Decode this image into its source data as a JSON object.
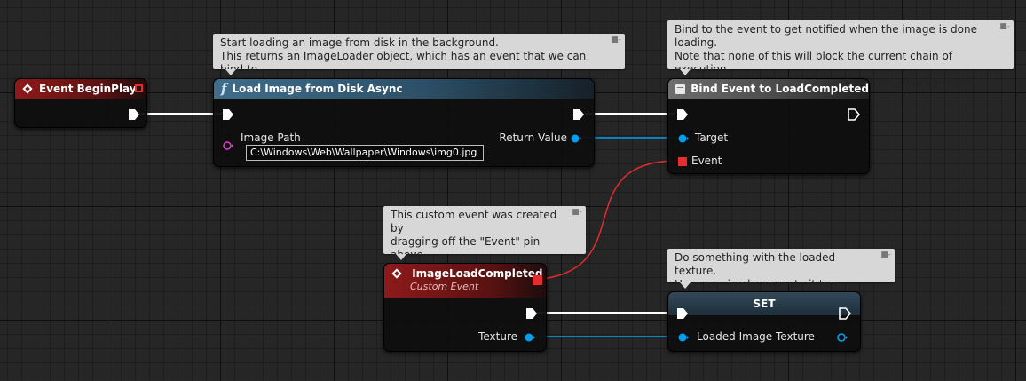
{
  "comments": {
    "load": "Start loading an image from disk in the background.\nThis returns an ImageLoader object, which has an event that we can bind to.",
    "bind": "Bind to the event to get notified when the image is done loading.\nNote that none of this will block the current chain of execution,\nbecause all of the heavy work is done on a background thread.",
    "custom": "This custom event was created by\ndragging off the \"Event\" pin above\nand selecting \"Add Custom Event\".",
    "set": "Do something with the loaded texture.\nHere we simply promote it to a variable."
  },
  "nodes": {
    "begin_play": {
      "title": "Event BeginPlay"
    },
    "load_image": {
      "title": "Load Image from Disk Async",
      "image_path_label": "Image Path",
      "image_path_value": "C:\\Windows\\Web\\Wallpaper\\Windows\\img0.jpg",
      "return_label": "Return Value"
    },
    "bind_event": {
      "title": "Bind Event to LoadCompleted",
      "target_label": "Target",
      "event_label": "Event"
    },
    "custom_event": {
      "title": "ImageLoadCompleted",
      "subtitle": "Custom Event",
      "texture_label": "Texture"
    },
    "set": {
      "title": "SET",
      "var_label": "Loaded Image Texture"
    }
  },
  "colors": {
    "exec_wire": "#ffffff",
    "object_pin": "#00a0f0",
    "delegate_pin": "#e52d2d",
    "string_pin": "#e03dce"
  }
}
